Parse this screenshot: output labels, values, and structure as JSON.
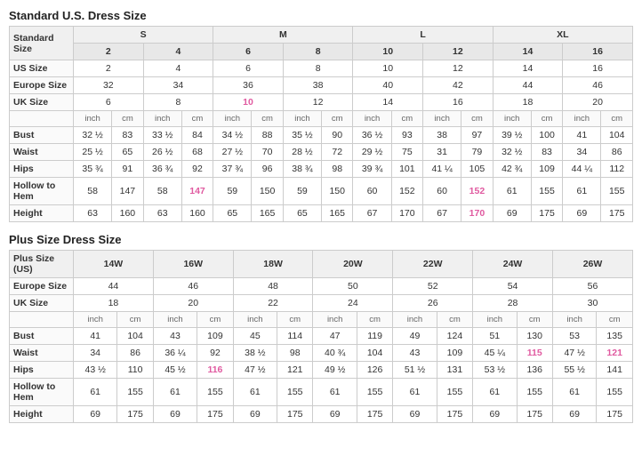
{
  "standard": {
    "title": "Standard U.S. Dress Size",
    "sizeGroups": [
      "S",
      "M",
      "L",
      "XL"
    ],
    "headers": {
      "standardSize": "Standard Size",
      "usSize": "US Size",
      "europeSize": "Europe Size",
      "ukSize": "UK Size"
    },
    "usSizes": [
      "2",
      "4",
      "6",
      "8",
      "10",
      "12",
      "14",
      "16"
    ],
    "europeSizes": [
      "32",
      "34",
      "36",
      "38",
      "40",
      "42",
      "44",
      "46"
    ],
    "ukSizes": [
      "6",
      "8",
      "10",
      "12",
      "14",
      "16",
      "18",
      "20"
    ],
    "measurements": [
      {
        "label": "Bust",
        "values": [
          "32 ½",
          "83",
          "33 ½",
          "84",
          "34 ½",
          "88",
          "35 ½",
          "90",
          "36 ½",
          "93",
          "38",
          "97",
          "39 ½",
          "100",
          "41",
          "104"
        ]
      },
      {
        "label": "Waist",
        "values": [
          "25 ½",
          "65",
          "26 ½",
          "68",
          "27 ½",
          "70",
          "28 ½",
          "72",
          "29 ½",
          "75",
          "31",
          "79",
          "32 ½",
          "83",
          "34",
          "86"
        ]
      },
      {
        "label": "Hips",
        "values": [
          "35 ¾",
          "91",
          "36 ¾",
          "92",
          "37 ¾",
          "96",
          "38 ¾",
          "98",
          "39 ¾",
          "101",
          "41 ¼",
          "105",
          "42 ¾",
          "109",
          "44 ¼",
          "112"
        ]
      },
      {
        "label": "Hollow to Hem",
        "values": [
          "58",
          "147",
          "58",
          "147",
          "59",
          "150",
          "59",
          "150",
          "60",
          "152",
          "60",
          "152",
          "61",
          "155",
          "61",
          "155"
        ],
        "pinkIndices": [
          7,
          11
        ]
      },
      {
        "label": "Height",
        "values": [
          "63",
          "160",
          "63",
          "160",
          "65",
          "165",
          "65",
          "165",
          "67",
          "170",
          "67",
          "170",
          "69",
          "175",
          "69",
          "175"
        ],
        "pinkIndices": [
          7,
          11
        ]
      }
    ]
  },
  "plus": {
    "title": "Plus Size Dress Size",
    "headers": {
      "plusSize": "Plus Size (US)",
      "europeSize": "Europe Size",
      "ukSize": "UK Size"
    },
    "plusSizes": [
      "14W",
      "16W",
      "18W",
      "20W",
      "22W",
      "24W",
      "26W"
    ],
    "europeSizes": [
      "44",
      "46",
      "48",
      "50",
      "52",
      "54",
      "56"
    ],
    "ukSizes": [
      "18",
      "20",
      "22",
      "24",
      "26",
      "28",
      "30"
    ],
    "measurements": [
      {
        "label": "Bust",
        "values": [
          "41",
          "104",
          "43",
          "109",
          "45",
          "114",
          "47",
          "119",
          "49",
          "124",
          "51",
          "130",
          "53",
          "135"
        ]
      },
      {
        "label": "Waist",
        "values": [
          "34",
          "86",
          "36 ¼",
          "92",
          "38 ½",
          "98",
          "40 ¾",
          "104",
          "43",
          "109",
          "45 ¼",
          "115",
          "47 ½",
          "121"
        ],
        "pinkIndices": [
          11,
          13
        ]
      },
      {
        "label": "Hips",
        "values": [
          "43 ½",
          "110",
          "45 ½",
          "116",
          "47 ½",
          "121",
          "49 ½",
          "126",
          "51 ½",
          "131",
          "53 ½",
          "136",
          "55 ½",
          "141"
        ],
        "pinkIndices": [
          3,
          7
        ]
      },
      {
        "label": "Hollow to Hem",
        "values": [
          "61",
          "155",
          "61",
          "155",
          "61",
          "155",
          "61",
          "155",
          "61",
          "155",
          "61",
          "155",
          "61",
          "155"
        ]
      },
      {
        "label": "Height",
        "values": [
          "69",
          "175",
          "69",
          "175",
          "69",
          "175",
          "69",
          "175",
          "69",
          "175",
          "69",
          "175",
          "69",
          "175"
        ]
      }
    ]
  }
}
